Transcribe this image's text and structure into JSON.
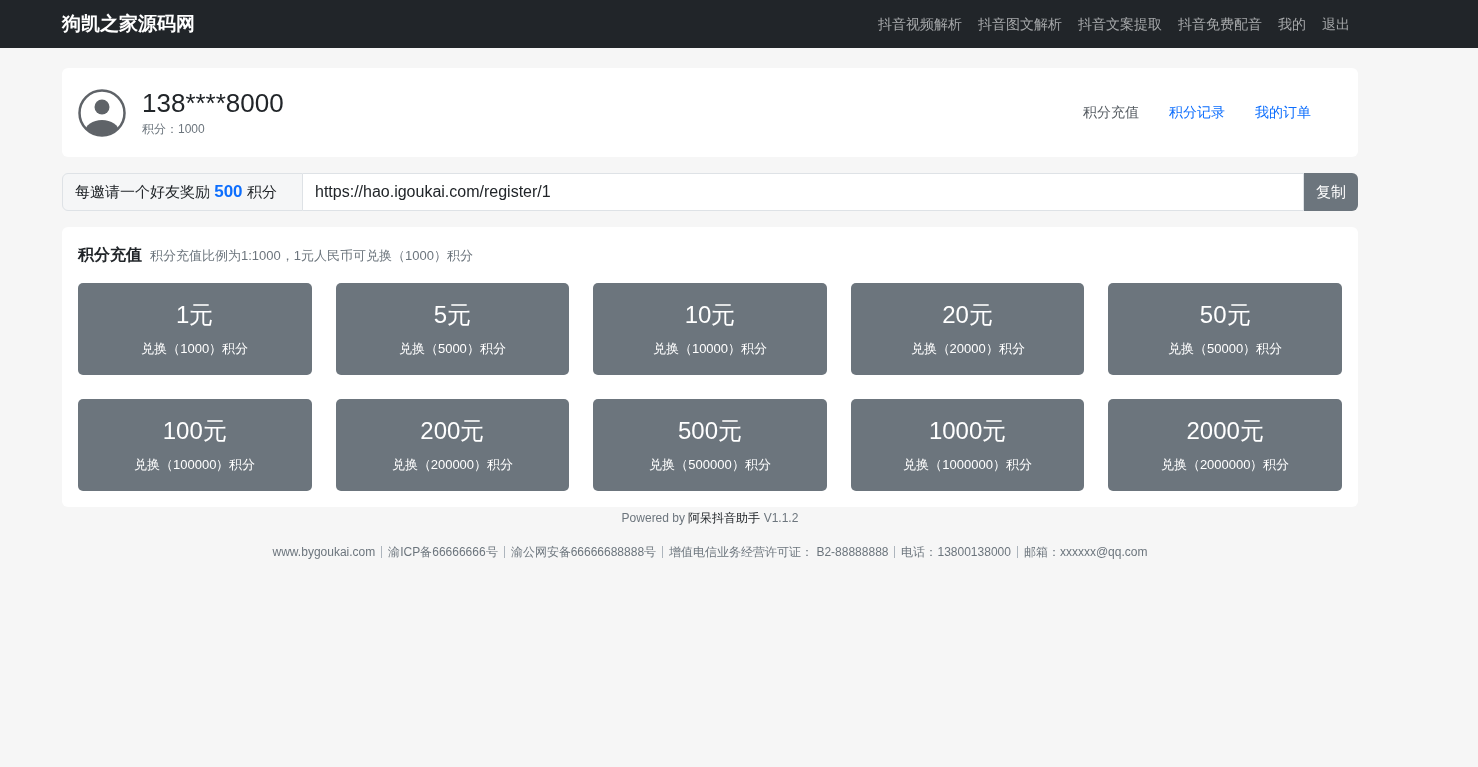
{
  "navbar": {
    "brand": "狗凯之家源码网",
    "links": [
      "抖音视频解析",
      "抖音图文解析",
      "抖音文案提取",
      "抖音免费配音",
      "我的",
      "退出"
    ]
  },
  "profile": {
    "username": "138****8000",
    "points": "积分：1000",
    "links": [
      {
        "label": "积分充值",
        "selected": true
      },
      {
        "label": "积分记录",
        "selected": false
      },
      {
        "label": "我的订单",
        "selected": false
      }
    ]
  },
  "invite": {
    "reward": "每邀请一个好友奖励 **500** 积分",
    "link": "https://hao.igoukai.com/register/1",
    "button": "复制"
  },
  "recharge": {
    "title": "积分充值",
    "subtitle": "积分充值比例为1:1000，1元人民币可兑换（1000）积分",
    "options": [
      {
        "amount": "1元",
        "points": "兑换（1000）积分"
      },
      {
        "amount": "5元",
        "points": "兑换（5000）积分"
      },
      {
        "amount": "10元",
        "points": "兑换（10000）积分"
      },
      {
        "amount": "20元",
        "points": "兑换（20000）积分"
      },
      {
        "amount": "50元",
        "points": "兑换（50000）积分"
      },
      {
        "amount": "100元",
        "points": "兑换（100000）积分"
      },
      {
        "amount": "200元",
        "points": "兑换（200000）积分"
      },
      {
        "amount": "500元",
        "points": "兑换（500000）积分"
      },
      {
        "amount": "1000元",
        "points": "兑换（1000000）积分"
      },
      {
        "amount": "2000元",
        "points": "兑换（2000000）积分"
      }
    ]
  },
  "footer": {
    "powered_prefix": "Powered by",
    "powered_name": "阿呆抖音助手",
    "version": "V1.1.2",
    "items": [
      "www.bygoukai.com",
      "渝ICP备66666666号",
      "渝公网安备66666688888号",
      "增值电信业务经营许可证： B2-88888888",
      "电话：13800138000",
      "邮箱：xxxxxx@qq.com"
    ]
  }
}
